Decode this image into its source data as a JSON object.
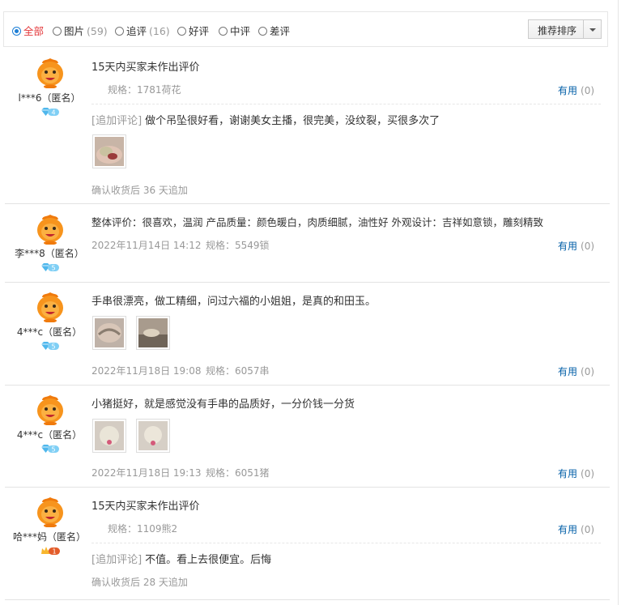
{
  "filters": [
    {
      "label": "全部",
      "count": "",
      "selected": true
    },
    {
      "label": "图片",
      "count": "(59)",
      "selected": false
    },
    {
      "label": "追评",
      "count": "(16)",
      "selected": false
    },
    {
      "label": "好评",
      "count": "",
      "selected": false
    },
    {
      "label": "中评",
      "count": "",
      "selected": false
    },
    {
      "label": "差评",
      "count": "",
      "selected": false
    }
  ],
  "sort_label": "推荐排序",
  "useful_label": "有用",
  "added_tag": "[追加评论]",
  "colors": {
    "accent": "#e4393c",
    "link": "#005ea7",
    "muted": "#999999",
    "radio": "#1e7fd6"
  },
  "reviews": [
    {
      "user": "l***6（匿名）",
      "badge": "4",
      "badge_icon": "diamond-icon",
      "content": "15天内买家未作出评价",
      "date": "",
      "spec": "规格：1781荷花",
      "useful_count": "(0)",
      "additional": "做个吊坠很好看，谢谢美女主播，很完美，没纹裂，买很多次了",
      "additional_when": "确认收货后 36 天追加",
      "images": [
        "photo-thumbnail"
      ]
    },
    {
      "user": "李***8（匿名）",
      "badge": "5",
      "badge_icon": "diamond-icon",
      "content": "整体评价：很喜欢，温润 产品质量：颜色暖白，肉质细腻，油性好 外观设计：吉祥如意锁，雕刻精致",
      "date": "2022年11月14日 14:12",
      "spec": "规格：5549锁",
      "useful_count": "(0)",
      "images": []
    },
    {
      "user": "4***c（匿名）",
      "badge": "5",
      "badge_icon": "diamond-icon",
      "content": "手串很漂亮，做工精细，问过六福的小姐姐，是真的和田玉。",
      "date": "2022年11月18日 19:08",
      "spec": "规格：6057串",
      "useful_count": "(0)",
      "images": [
        "photo-thumbnail",
        "photo-thumbnail"
      ]
    },
    {
      "user": "4***c（匿名）",
      "badge": "5",
      "badge_icon": "diamond-icon",
      "content": "小猪挺好，就是感觉没有手串的品质好，一分价钱一分货",
      "date": "2022年11月18日 19:13",
      "spec": "规格：6051猪",
      "useful_count": "(0)",
      "images": [
        "photo-thumbnail",
        "photo-thumbnail"
      ]
    },
    {
      "user": "哈***妈（匿名）",
      "badge": "1",
      "badge_icon": "crown-icon",
      "content": "15天内买家未作出评价",
      "date": "",
      "spec": "规格：1109熊2",
      "useful_count": "(0)",
      "additional": "不值。看上去很便宜。后悔",
      "additional_when": "确认收货后 28 天追加",
      "images": []
    }
  ]
}
